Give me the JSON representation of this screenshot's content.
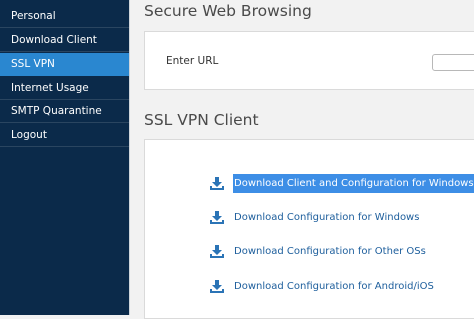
{
  "sidebar": {
    "items": [
      {
        "label": "Personal",
        "active": false
      },
      {
        "label": "Download Client",
        "active": false
      },
      {
        "label": "SSL VPN",
        "active": true
      },
      {
        "label": "Internet Usage",
        "active": false
      },
      {
        "label": "SMTP Quarantine",
        "active": false
      },
      {
        "label": "Logout",
        "active": false
      }
    ]
  },
  "secure_browsing": {
    "title": "Secure Web Browsing",
    "url_label": "Enter URL",
    "url_value": ""
  },
  "vpn_client": {
    "title": "SSL VPN Client",
    "icon": "download-icon",
    "links": [
      {
        "label": "Download Client and Configuration for Windows",
        "selected": true
      },
      {
        "label": "Download Configuration for Windows",
        "selected": false
      },
      {
        "label": "Download Configuration for Other OSs",
        "selected": false
      },
      {
        "label": "Download Configuration for Android/iOS",
        "selected": false
      }
    ]
  },
  "colors": {
    "sidebar_bg": "#0b2a4a",
    "sidebar_active": "#2a87d0",
    "link": "#1d5e9c",
    "selection": "#3d8ee6",
    "page_bg": "#f2f2f2"
  }
}
